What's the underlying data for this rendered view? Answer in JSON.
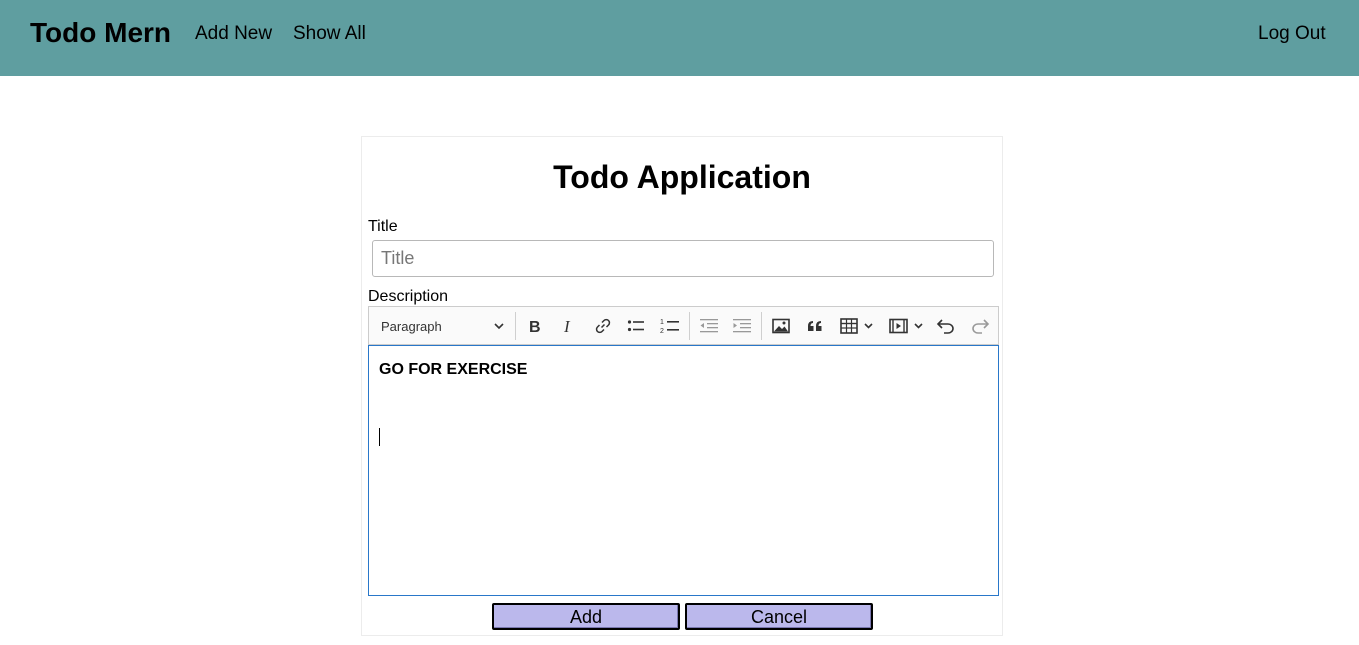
{
  "navbar": {
    "brand": "Todo Mern",
    "add_new": "Add New",
    "show_all": "Show All",
    "log_out": "Log Out",
    "background_color": "#5f9ea0"
  },
  "form": {
    "heading": "Todo Application",
    "title_label": "Title",
    "title_placeholder": "Title",
    "title_value": "",
    "description_label": "Description",
    "editor_content": "GO FOR EXERCISE",
    "add_button": "Add",
    "cancel_button": "Cancel",
    "button_color": "#bbb8ec"
  },
  "toolbar": {
    "heading_select": "Paragraph",
    "tools": [
      "bold-icon",
      "italic-icon",
      "link-icon",
      "bulleted-list-icon",
      "numbered-list-icon",
      "outdent-icon",
      "indent-icon",
      "image-icon",
      "blockquote-icon",
      "table-icon",
      "media-icon",
      "undo-icon",
      "redo-icon"
    ]
  }
}
